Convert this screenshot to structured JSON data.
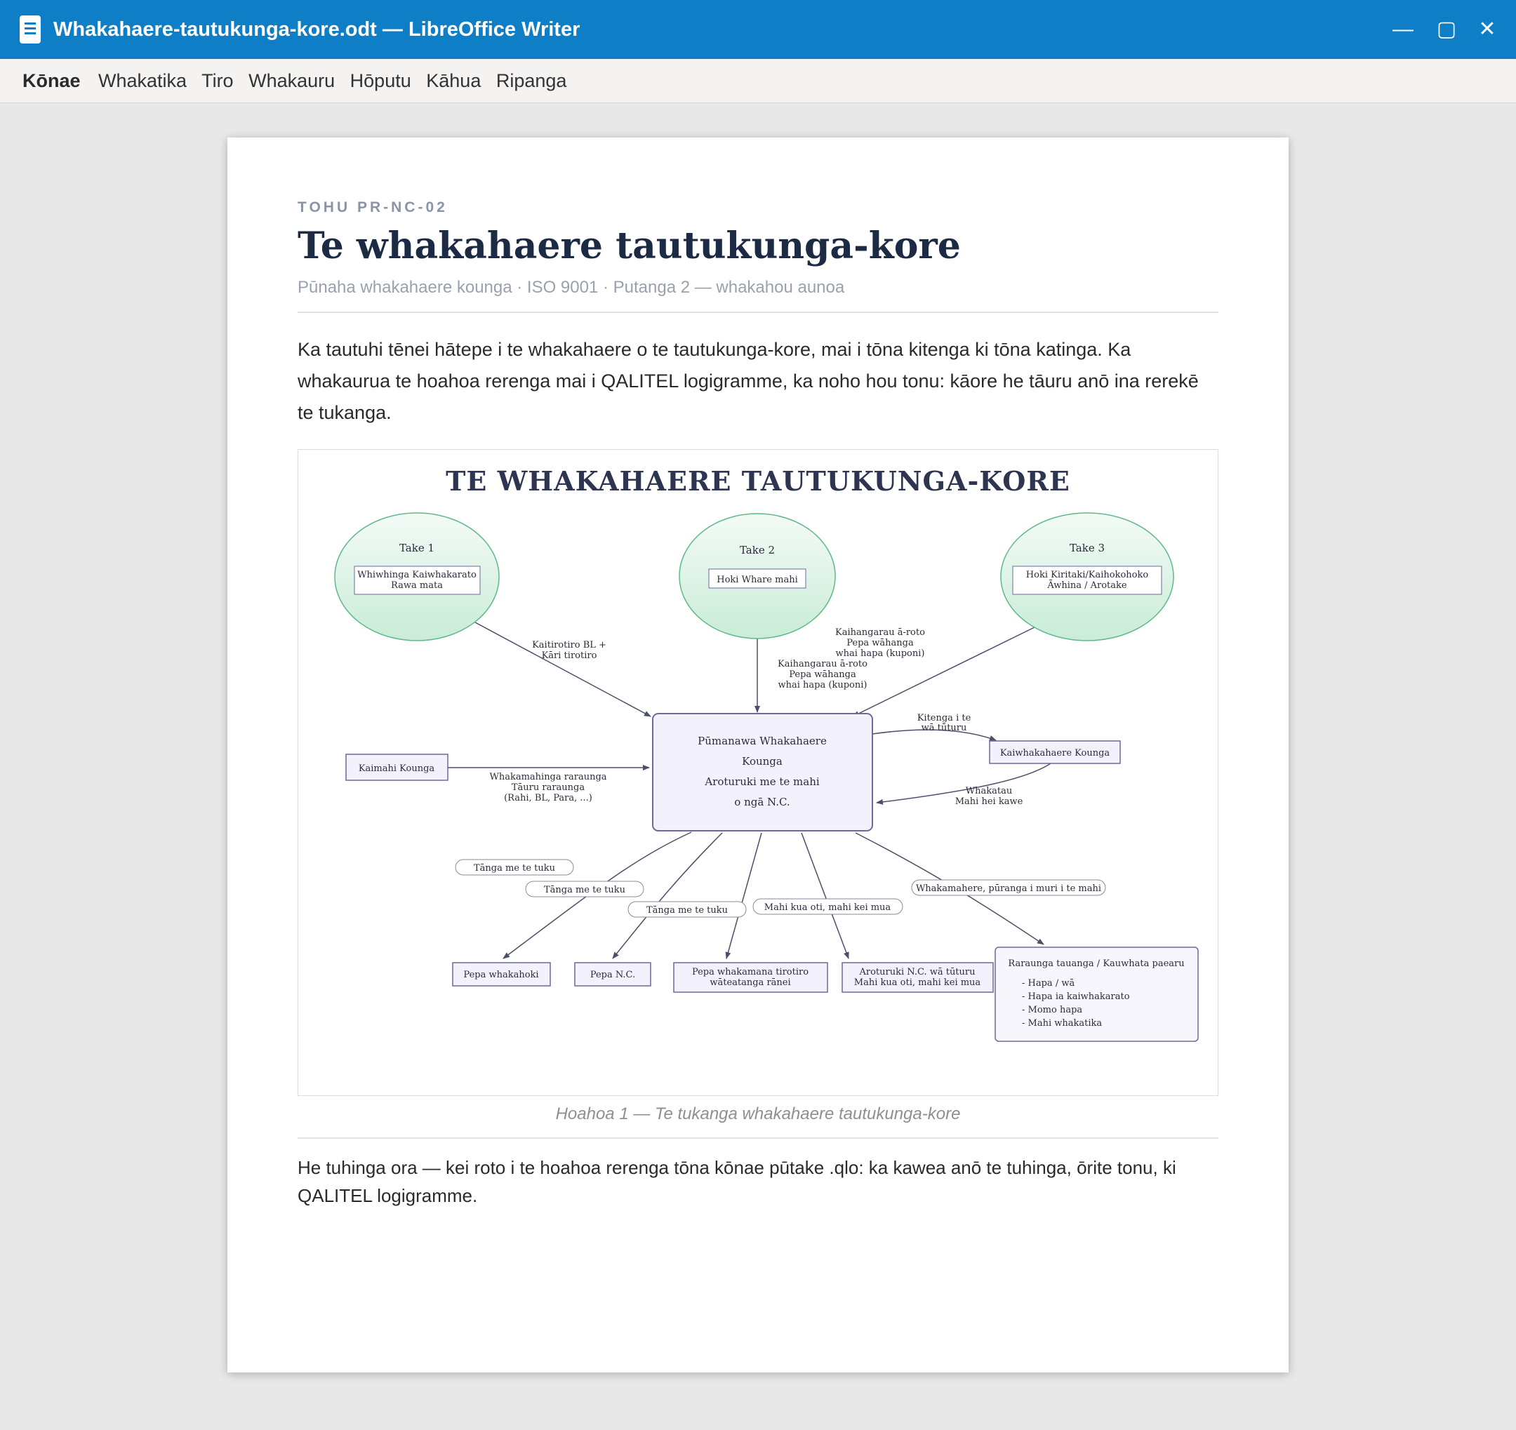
{
  "window": {
    "title": "Whakahaere-tautukunga-kore.odt — LibreOffice Writer",
    "minimize": "—",
    "maximize": "▢",
    "close": "✕"
  },
  "menu": {
    "active": "Kōnae",
    "items": [
      "Whakatika",
      "Tiro",
      "Whakauru",
      "Hōputu",
      "Kāhua",
      "Ripanga"
    ]
  },
  "document": {
    "ref": "TOHU PR-NC-02",
    "title": "Te whakahaere tautukunga-kore",
    "subtitle": "Pūnaha whakahaere kounga · ISO 9001 · Putanga 2 — whakahou aunoa",
    "intro": "Ka tautuhi tēnei hātepe i te whakahaere o te tautukunga-kore, mai i tōna kitenga ki tōna katinga. Ka whakaurua te hoahoa rerenga mai i QALITEL logigramme, ka noho hou tonu: kāore he tāuru anō ina rerekē te tukanga.",
    "caption": "Hoahoa 1 — Te tukanga whakahaere tautukunga-kore",
    "footer": "He tuhinga ora — kei roto i te hoahoa rerenga tōna kōnae pūtake .qlo: ka kawea anō te tuhinga, ōrite tonu, ki QALITEL logigramme."
  },
  "diagram": {
    "title": "TE WHAKAHAERE TAUTUKUNGA-KORE",
    "colors": {
      "ellipse_fill": "#d8f1e4",
      "ellipse_stroke": "#5fb98a",
      "box_fill": "#f3f1fb",
      "box_stroke": "#6b6a9a",
      "arrow": "#4a5068",
      "title": "#2e3550"
    },
    "steps": [
      {
        "label": "Take 1",
        "box": [
          "Whiwhinga Kaiwhakarato",
          "Rawa mata"
        ]
      },
      {
        "label": "Take 2",
        "box": [
          "Hoki Whare mahi"
        ]
      },
      {
        "label": "Take 3",
        "box": [
          "Hoki Kiritaki/Kaihokohoko",
          "Āwhina / Arotake"
        ]
      }
    ],
    "central": [
      "Pūmanawa Whakahaere",
      "Kounga",
      "Aroturuki me te mahi",
      "o ngā N.C."
    ],
    "left_actor": "Kaimahi Kounga",
    "right_actor": "Kaiwhakahaere Kounga",
    "edge_labels": {
      "step1": [
        "Kaitirotiro BL +",
        "Kāri tirotiro"
      ],
      "step3": [
        "Kaihangarau ā-roto",
        "Pepa wāhanga",
        "whai hapa (kuponi)"
      ],
      "step2": [
        "Kaihangarau ā-roto",
        "Pepa wāhanga",
        "whai hapa (kuponi)"
      ],
      "left": [
        "Whakamahinga raraunga",
        "Tāuru raraunga",
        "(Rahi, BL, Para, ...)"
      ],
      "to_right": [
        "Kitenga i te",
        "wā tūturu"
      ],
      "from_right": [
        "Whakatau",
        "Mahi hei kawe"
      ]
    },
    "pills": [
      "Tānga me te tuku",
      "Tānga me te tuku",
      "Tānga me te tuku",
      "Mahi kua oti, mahi kei mua",
      "Whakamahere, pūranga i muri i te mahi"
    ],
    "outputs": [
      {
        "lines": [
          "Pepa whakahoki"
        ]
      },
      {
        "lines": [
          "Pepa N.C."
        ]
      },
      {
        "lines": [
          "Pepa whakamana tirotiro",
          "wāteatanga rānei"
        ]
      },
      {
        "lines": [
          "Aroturuki N.C. wā tūturu",
          "Mahi kua oti, mahi kei mua"
        ]
      }
    ],
    "report": {
      "title": "Raraunga tauanga / Kauwhata paearu",
      "items": [
        "- Hapa / wā",
        "- Hapa ia kaiwhakarato",
        "- Momo hapa",
        "- Mahi whakatika"
      ]
    }
  }
}
